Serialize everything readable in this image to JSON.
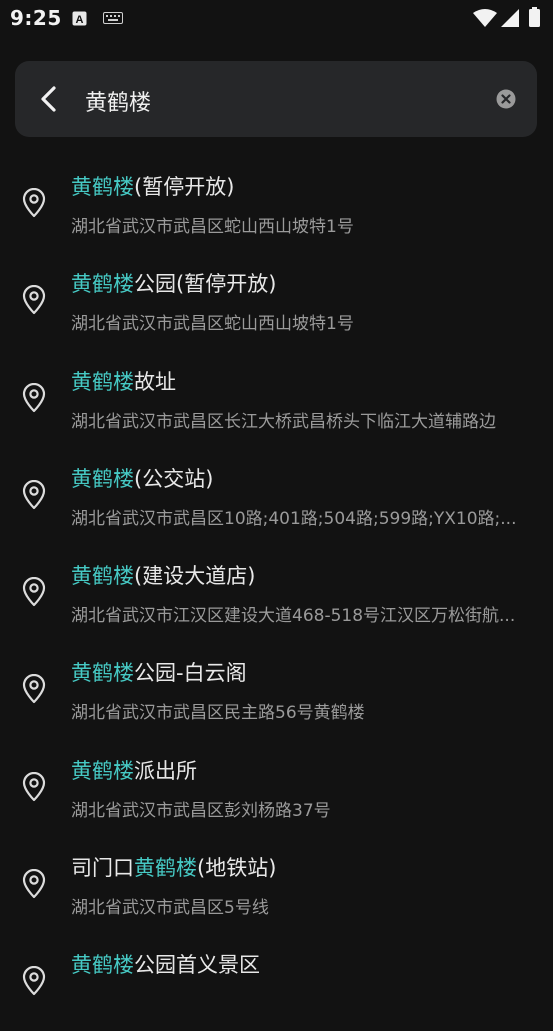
{
  "status_bar": {
    "time": "9:25",
    "icons": [
      "a-notification-icon",
      "keyboard-icon",
      "wifi-icon",
      "signal-icon",
      "battery-icon"
    ]
  },
  "search": {
    "query": "黄鹤楼",
    "back_icon": "chevron-left-icon",
    "clear_icon": "clear-circle-icon"
  },
  "colors": {
    "highlight": "#46c9c4",
    "background": "#121212",
    "search_bg": "#262729"
  },
  "results": [
    {
      "pre": "",
      "hl": "黄鹤楼",
      "post": "(暂停开放)",
      "address": "湖北省武汉市武昌区蛇山西山坡特1号"
    },
    {
      "pre": "",
      "hl": "黄鹤楼",
      "post": "公园(暂停开放)",
      "address": "湖北省武汉市武昌区蛇山西山坡特1号"
    },
    {
      "pre": "",
      "hl": "黄鹤楼",
      "post": "故址",
      "address": "湖北省武汉市武昌区长江大桥武昌桥头下临江大道辅路边"
    },
    {
      "pre": "",
      "hl": "黄鹤楼",
      "post": "(公交站)",
      "address": "湖北省武汉市武昌区10路;401路;504路;599路;YX10路;..."
    },
    {
      "pre": "",
      "hl": "黄鹤楼",
      "post": "(建设大道店)",
      "address": "湖北省武汉市江汉区建设大道468-518号江汉区万松街航..."
    },
    {
      "pre": "",
      "hl": "黄鹤楼",
      "post": "公园-白云阁",
      "address": "湖北省武汉市武昌区民主路56号黄鹤楼"
    },
    {
      "pre": "",
      "hl": "黄鹤楼",
      "post": "派出所",
      "address": "湖北省武汉市武昌区彭刘杨路37号"
    },
    {
      "pre": "司门口",
      "hl": "黄鹤楼",
      "post": "(地铁站)",
      "address": "湖北省武汉市武昌区5号线"
    },
    {
      "pre": "",
      "hl": "黄鹤楼",
      "post": "公园首义景区",
      "address": ""
    }
  ]
}
